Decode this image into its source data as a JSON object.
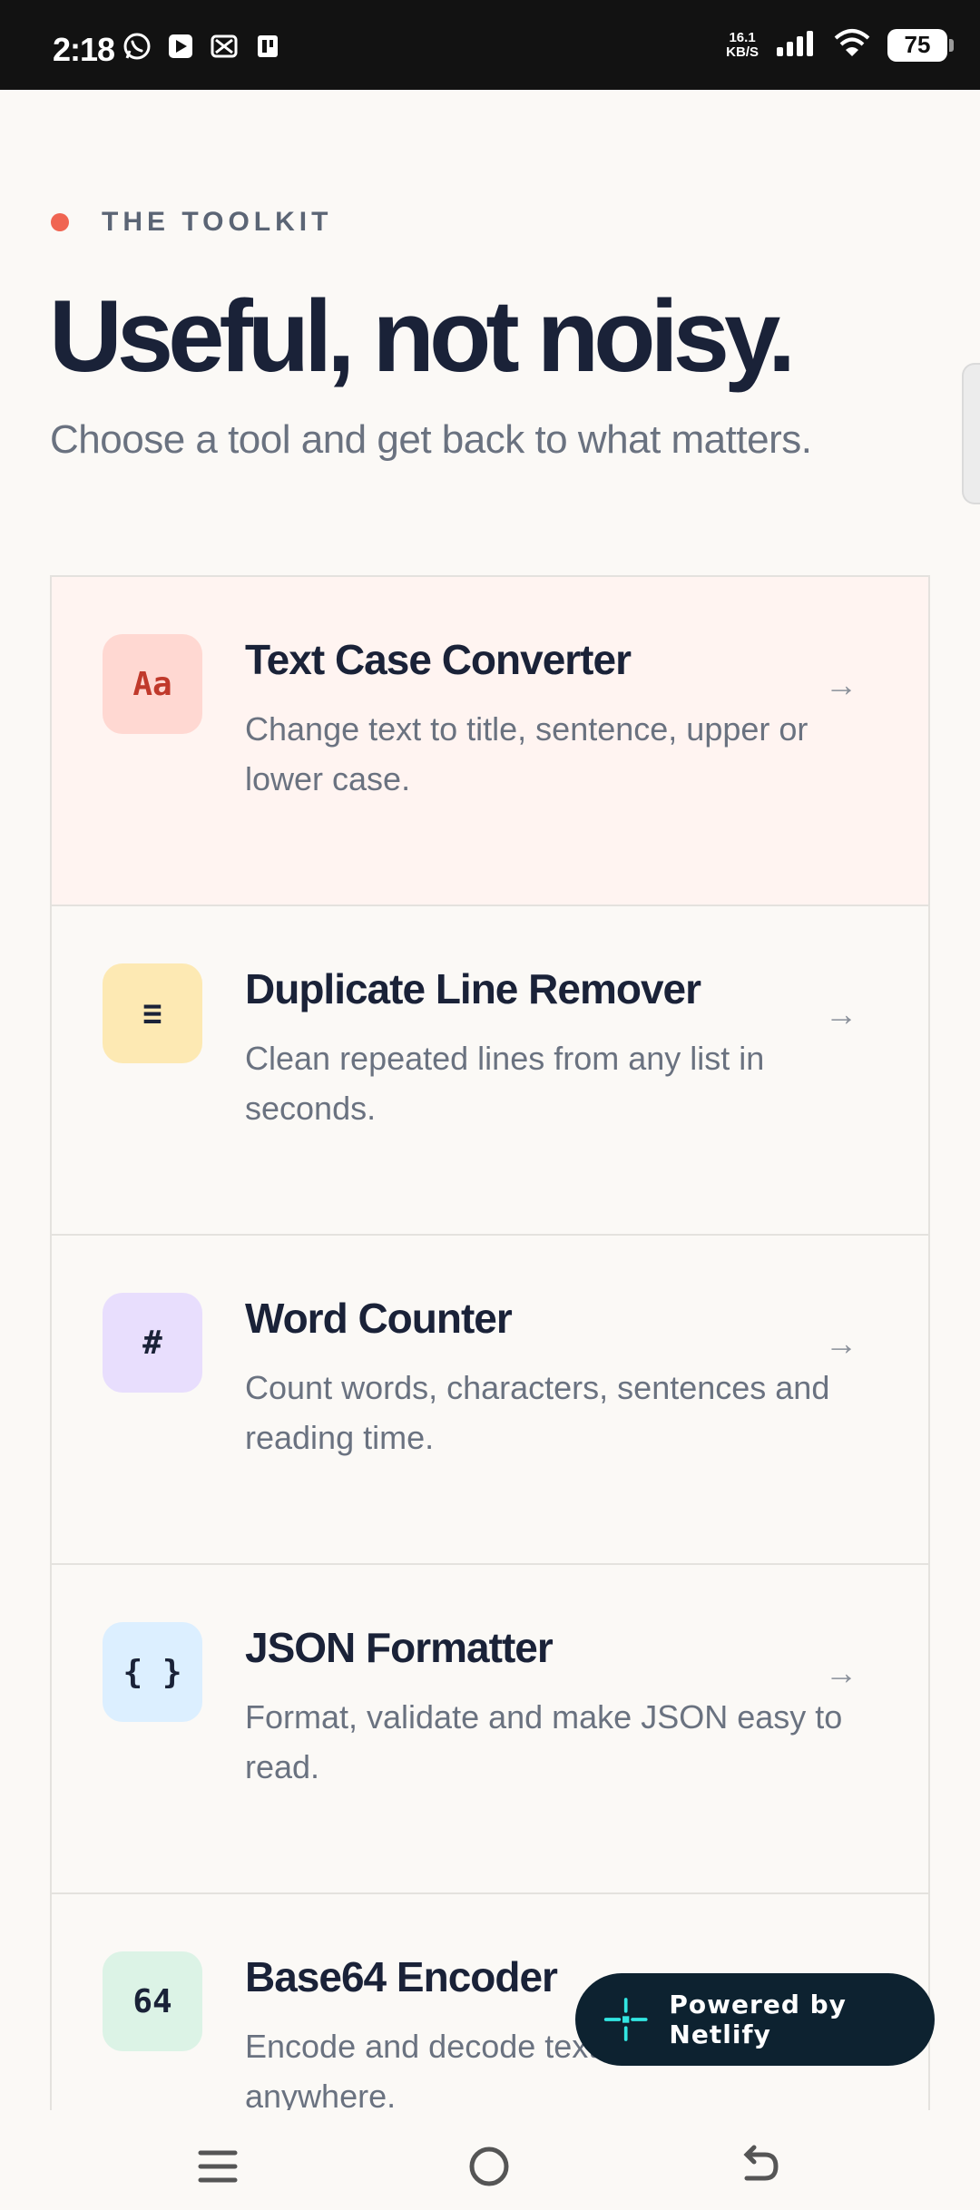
{
  "status_bar": {
    "time": "2:18",
    "speed_value": "16.1",
    "speed_unit": "KB/S",
    "battery": "75"
  },
  "eyebrow": "THE TOOLKIT",
  "headline": "Useful, not noisy.",
  "subhead": "Choose a tool and get back to what matters.",
  "tools": [
    {
      "icon": "Aa",
      "title": "Text Case Converter",
      "desc": "Change text to title, sentence, upper or lower case.",
      "icon_bg": "#ffd8d2",
      "icon_color": "#c0392b"
    },
    {
      "icon": "≡",
      "title": "Duplicate Line Remover",
      "desc": "Clean repeated lines from any list in seconds.",
      "icon_bg": "#fde9b3",
      "icon_color": "#1a2238"
    },
    {
      "icon": "#",
      "title": "Word Counter",
      "desc": "Count words, characters, sentences and reading time.",
      "icon_bg": "#e8defd",
      "icon_color": "#1a2238"
    },
    {
      "icon": "{ }",
      "title": "JSON Formatter",
      "desc": "Format, validate and make JSON easy to read.",
      "icon_bg": "#dcefff",
      "icon_color": "#1a2238"
    },
    {
      "icon": "64",
      "title": "Base64 Encoder",
      "desc": "Encode and decode text safely to use it anywhere.",
      "icon_bg": "#dcf3e6",
      "icon_color": "#1a2238"
    }
  ],
  "arrow": "→",
  "netlify_badge": "Powered by Netlify",
  "colors": {
    "accent": "#f06552",
    "ink": "#1a2238",
    "muted": "#6a7280",
    "active_card": "#fff4f1"
  }
}
